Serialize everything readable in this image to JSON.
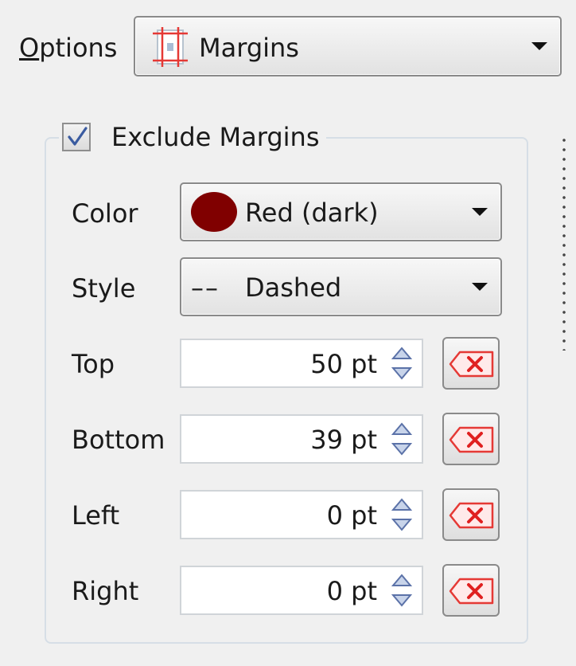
{
  "options": {
    "label_underlined": "O",
    "label_rest": "ptions"
  },
  "mode": {
    "selected": "Margins",
    "icon": "margins-icon"
  },
  "group": {
    "title": "Exclude Margins",
    "checked": true
  },
  "color": {
    "label": "Color",
    "selected": "Red (dark)",
    "swatch": "#800000"
  },
  "style": {
    "label": "Style",
    "selected": "Dashed",
    "line_glyph": "––"
  },
  "margins": [
    {
      "label": "Top",
      "value": "50 pt"
    },
    {
      "label": "Bottom",
      "value": "39 pt"
    },
    {
      "label": "Left",
      "value": "0 pt"
    },
    {
      "label": "Right",
      "value": "0 pt"
    }
  ],
  "colors": {
    "accent": "#e53935",
    "checkmark": "#3a5ba0",
    "border": "#8a8a8a"
  }
}
